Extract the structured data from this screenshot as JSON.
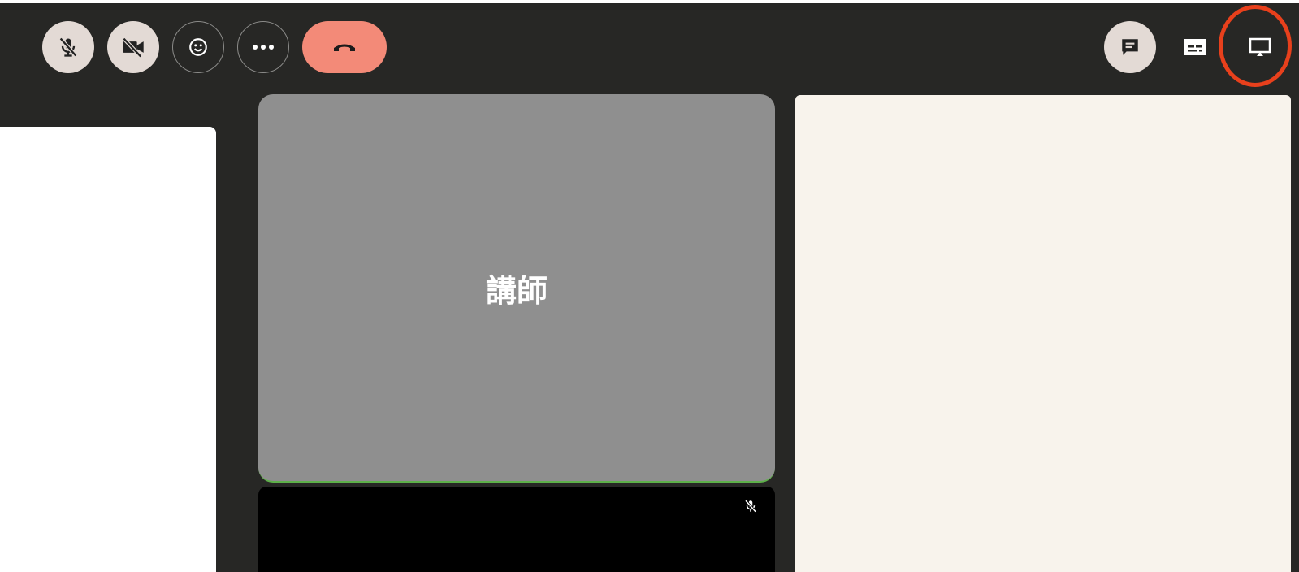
{
  "toolbar": {
    "left_buttons": [
      {
        "id": "mic",
        "icon": "mic-off-icon"
      },
      {
        "id": "camera",
        "icon": "camera-off-icon"
      },
      {
        "id": "reactions",
        "icon": "emoji-icon"
      },
      {
        "id": "more",
        "icon": "more-options-icon"
      },
      {
        "id": "leave",
        "icon": "hang-up-icon"
      }
    ],
    "right_buttons": [
      {
        "id": "chat",
        "icon": "chat-icon"
      },
      {
        "id": "captions",
        "icon": "captions-icon"
      },
      {
        "id": "present",
        "icon": "present-screen-icon"
      }
    ]
  },
  "tiles": {
    "main_participant_name": "講師"
  },
  "colors": {
    "background": "#272725",
    "button_fill": "#e3dad5",
    "leave_button": "#f38a78",
    "highlight_ring": "#e8401c",
    "tile_placeholder": "#8f8f8f",
    "side_panel": "#f8f3ec"
  }
}
